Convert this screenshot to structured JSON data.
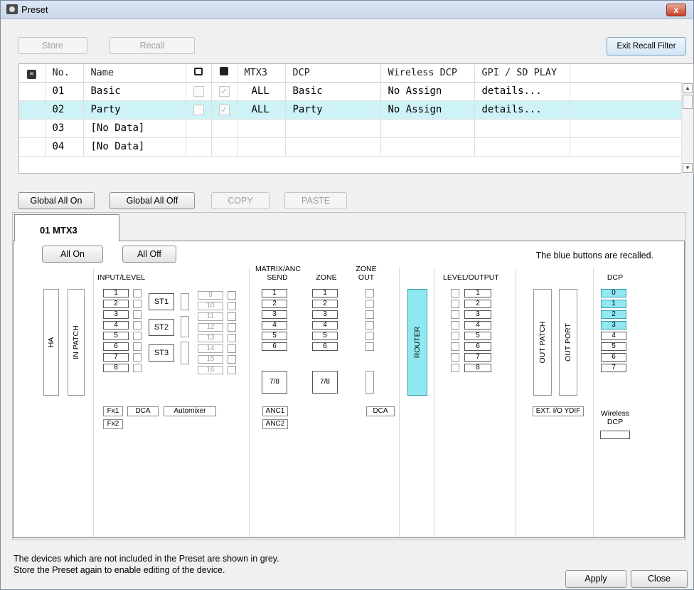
{
  "window": {
    "title": "Preset",
    "close": "x"
  },
  "toolbar": {
    "store": "Store",
    "recall": "Recall",
    "exit_recall_filter": "Exit Recall Filter"
  },
  "grid": {
    "columns": [
      "No.",
      "Name",
      "MTX3",
      "DCP",
      "Wireless DCP",
      "GPI / SD PLAY"
    ],
    "rows": [
      {
        "no": "01",
        "name": "Basic",
        "mtx3": "ALL",
        "dcp": "Basic",
        "wdcp": "No Assign",
        "gpi": "details..."
      },
      {
        "no": "02",
        "name": "Party",
        "mtx3": "ALL",
        "dcp": "Party",
        "wdcp": "No Assign",
        "gpi": "details..."
      },
      {
        "no": "03",
        "name": "[No Data]",
        "mtx3": "",
        "dcp": "",
        "wdcp": "",
        "gpi": ""
      },
      {
        "no": "04",
        "name": "[No Data]",
        "mtx3": "",
        "dcp": "",
        "wdcp": "",
        "gpi": ""
      }
    ],
    "selected_row": "02"
  },
  "actions": {
    "global_all_on": "Global All On",
    "global_all_off": "Global All Off",
    "copy": "COPY",
    "paste": "PASTE"
  },
  "tab": {
    "label": "01 MTX3"
  },
  "panel": {
    "all_on": "All On",
    "all_off": "All Off",
    "recalled_note": "The blue buttons are recalled.",
    "ha": "HA",
    "in_patch": "IN PATCH",
    "input_level": "INPUT/LEVEL",
    "inputs_a": [
      "1",
      "2",
      "3",
      "4",
      "5",
      "6",
      "7",
      "8"
    ],
    "inputs_b": [
      "9",
      "10",
      "11",
      "12",
      "13",
      "14",
      "15",
      "16"
    ],
    "st": [
      "ST1",
      "ST2",
      "ST3"
    ],
    "fx1": "Fx1",
    "fx2": "Fx2",
    "dca": "DCA",
    "automixer": "Automixer",
    "matrix_anc_send": "MATRIX/ANC\nSEND",
    "zone": "ZONE",
    "zone_out": "ZONE\nOUT",
    "sends": [
      "1",
      "2",
      "3",
      "4",
      "5",
      "6"
    ],
    "seven_eight": "7/8",
    "anc1": "ANC1",
    "anc2": "ANC2",
    "zone_dca": "DCA",
    "router": "ROUTER",
    "level_output": "LEVEL/OUTPUT",
    "outputs": [
      "1",
      "2",
      "3",
      "4",
      "5",
      "6",
      "7",
      "8"
    ],
    "out_patch": "OUT PATCH",
    "out_port": "OUT PORT",
    "ext_io": "EXT. I/O YDIF",
    "dcp_label": "DCP",
    "dcp": [
      "0",
      "1",
      "2",
      "3",
      "4",
      "5",
      "6",
      "7"
    ],
    "dcp_blue": [
      true,
      true,
      true,
      true,
      false,
      false,
      false,
      false
    ],
    "wireless_dcp": "Wireless\nDCP"
  },
  "footer": {
    "note1": "The devices which are not included in the Preset are shown in grey.",
    "note2": "Store the Preset again to enable editing of the device.",
    "apply": "Apply",
    "close": "Close"
  }
}
